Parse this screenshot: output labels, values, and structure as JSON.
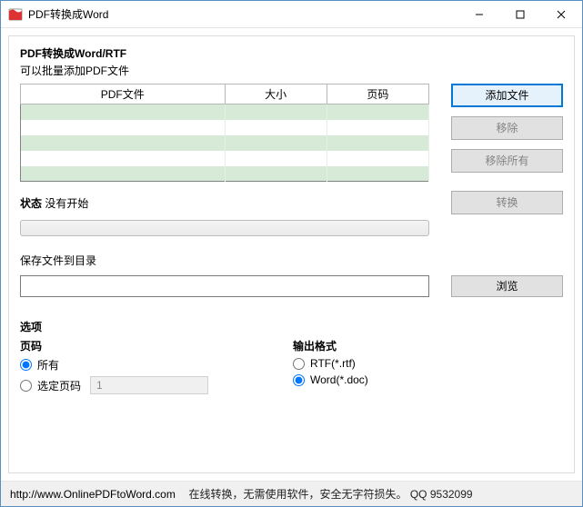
{
  "window": {
    "title": "PDF转换成Word"
  },
  "header": {
    "title": "PDF转换成Word/RTF",
    "subtitle": "可以批量添加PDF文件"
  },
  "table": {
    "col_file": "PDF文件",
    "col_size": "大小",
    "col_pages": "页码"
  },
  "buttons": {
    "add": "添加文件",
    "remove": "移除",
    "remove_all": "移除所有",
    "convert": "转换",
    "browse": "浏览"
  },
  "status": {
    "label": "状态",
    "value": "没有开始"
  },
  "save": {
    "label": "保存文件到目录",
    "value": ""
  },
  "options": {
    "title": "选项",
    "pages_title": "页码",
    "pages_all": "所有",
    "pages_select": "选定页码",
    "pages_input": "1",
    "format_title": "输出格式",
    "format_rtf": "RTF(*.rtf)",
    "format_doc": "Word(*.doc)"
  },
  "footer": {
    "url": "http://www.OnlinePDFtoWord.com",
    "text": "在线转换，无需使用软件，安全无字符损失。 QQ 9532099"
  }
}
